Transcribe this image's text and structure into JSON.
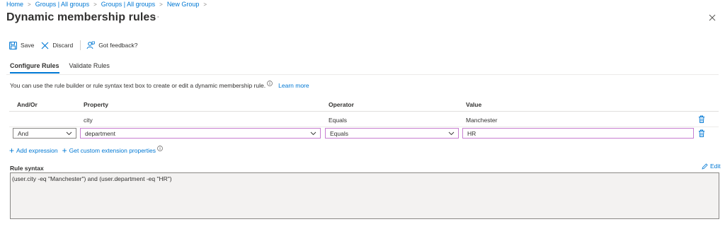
{
  "breadcrumb": [
    "Home",
    "Groups | All groups",
    "Groups | All groups",
    "New Group"
  ],
  "page": {
    "title": "Dynamic membership rules",
    "more_label": "···"
  },
  "toolbar": {
    "save_label": "Save",
    "discard_label": "Discard",
    "feedback_label": "Got feedback?"
  },
  "tabs": [
    {
      "label": "Configure Rules",
      "active": true
    },
    {
      "label": "Validate Rules",
      "active": false
    }
  ],
  "info": {
    "text": "You can use the rule builder or rule syntax text box to create or edit a dynamic membership rule.",
    "learn_more": "Learn more"
  },
  "table": {
    "columns": [
      "And/Or",
      "Property",
      "Operator",
      "Value"
    ],
    "rows": [
      {
        "and_or": "",
        "property": "city",
        "operator": "Equals",
        "value": "Manchester"
      },
      {
        "and_or": "And",
        "property": "department",
        "operator": "Equals",
        "value": "HR"
      }
    ]
  },
  "actions": {
    "add_expression": "Add expression",
    "custom_ext": "Get custom extension properties"
  },
  "rule_syntax": {
    "label": "Rule syntax",
    "edit_label": "Edit",
    "value": "(user.city -eq \"Manchester\") and (user.department -eq \"HR\")"
  },
  "colors": {
    "accent": "#0078d4",
    "focus_border": "#c77fd1"
  }
}
